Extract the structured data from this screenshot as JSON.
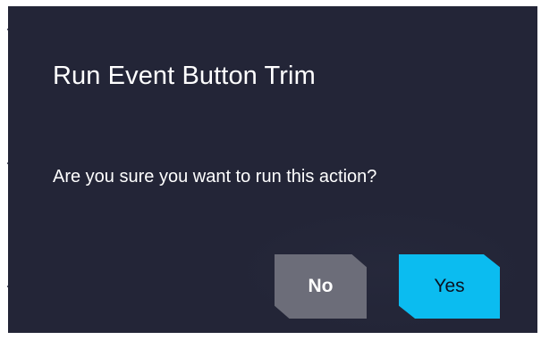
{
  "dialog": {
    "title": "Run Event Button Trim",
    "message": "Are you sure you want to run this action?"
  },
  "buttons": {
    "no_label": "No",
    "yes_label": "Yes"
  },
  "colors": {
    "dialog_background": "#232537",
    "text": "#ffffff",
    "no_button": "#6c6d79",
    "yes_button": "#0bbcf0"
  }
}
